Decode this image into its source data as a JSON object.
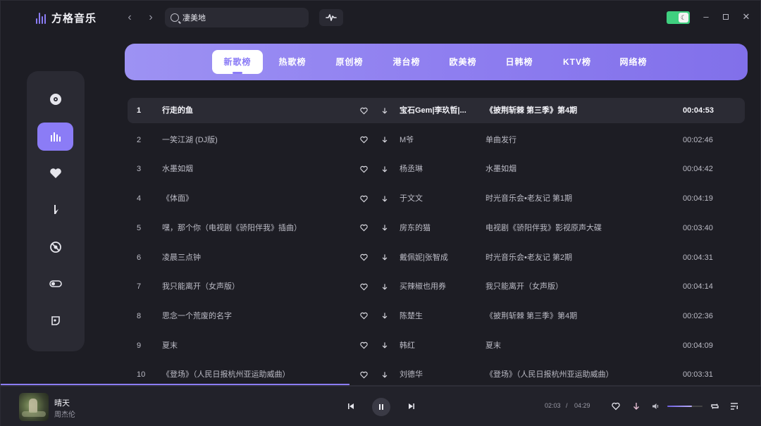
{
  "app": {
    "title": "方格音乐"
  },
  "search": {
    "value": "凄美地",
    "placeholder": ""
  },
  "tabs": [
    {
      "label": "新歌榜",
      "active": true
    },
    {
      "label": "热歌榜"
    },
    {
      "label": "原创榜"
    },
    {
      "label": "港台榜"
    },
    {
      "label": "欧美榜"
    },
    {
      "label": "日韩榜"
    },
    {
      "label": "KTV榜"
    },
    {
      "label": "网络榜"
    }
  ],
  "sidebar": {
    "items": [
      {
        "icon": "disc-icon"
      },
      {
        "icon": "chart-bars-icon",
        "active": true
      },
      {
        "icon": "heart-icon"
      },
      {
        "icon": "music-note-icon"
      },
      {
        "icon": "record-icon"
      },
      {
        "icon": "toggle-icon"
      },
      {
        "icon": "settings-icon"
      }
    ]
  },
  "songs": [
    {
      "num": "1",
      "title": "行走的鱼",
      "artist": "宝石Gem|李玖哲|...",
      "album": "《披荆斩棘 第三季》第4期",
      "time": "00:04:53"
    },
    {
      "num": "2",
      "title": "一笑江湖 (DJ版)",
      "artist": "M爷",
      "album": "单曲发行",
      "time": "00:02:46"
    },
    {
      "num": "3",
      "title": "水墨如烟",
      "artist": "杨丞琳",
      "album": "水墨如烟",
      "time": "00:04:42"
    },
    {
      "num": "4",
      "title": "《体面》",
      "artist": "于文文",
      "album": "时光音乐会•老友记 第1期",
      "time": "00:04:19"
    },
    {
      "num": "5",
      "title": "嘿，那个你（电视剧《骄阳伴我》插曲）",
      "artist": "房东的猫",
      "album": "电视剧《骄阳伴我》影视原声大碟",
      "time": "00:03:40"
    },
    {
      "num": "6",
      "title": "凌晨三点钟",
      "artist": "戴佩妮|张智成",
      "album": "时光音乐会•老友记 第2期",
      "time": "00:04:31"
    },
    {
      "num": "7",
      "title": "我只能离开（女声版）",
      "artist": "买辣椒也用券",
      "album": "我只能离开（女声版）",
      "time": "00:04:14"
    },
    {
      "num": "8",
      "title": "思念一个荒废的名字",
      "artist": "陈楚生",
      "album": "《披荆斩棘 第三季》第4期",
      "time": "00:02:36"
    },
    {
      "num": "9",
      "title": "夏末",
      "artist": "韩红",
      "album": "夏末",
      "time": "00:04:09"
    },
    {
      "num": "10",
      "title": "《登场》（人民日报杭州亚运助威曲）",
      "artist": "刘德华",
      "album": "《登场》（人民日报杭州亚运助威曲）",
      "time": "00:03:31"
    }
  ],
  "player": {
    "song": "晴天",
    "artist": "周杰伦",
    "current_time": "02:03",
    "separator": "/",
    "total_time": "04:29",
    "progress": 0.458,
    "volume": 0.7
  },
  "colors": {
    "accent": "#8b7cf6",
    "toggle_green": "#3fcf7f",
    "background": "#1d1d24",
    "panel": "#2a2a33"
  }
}
